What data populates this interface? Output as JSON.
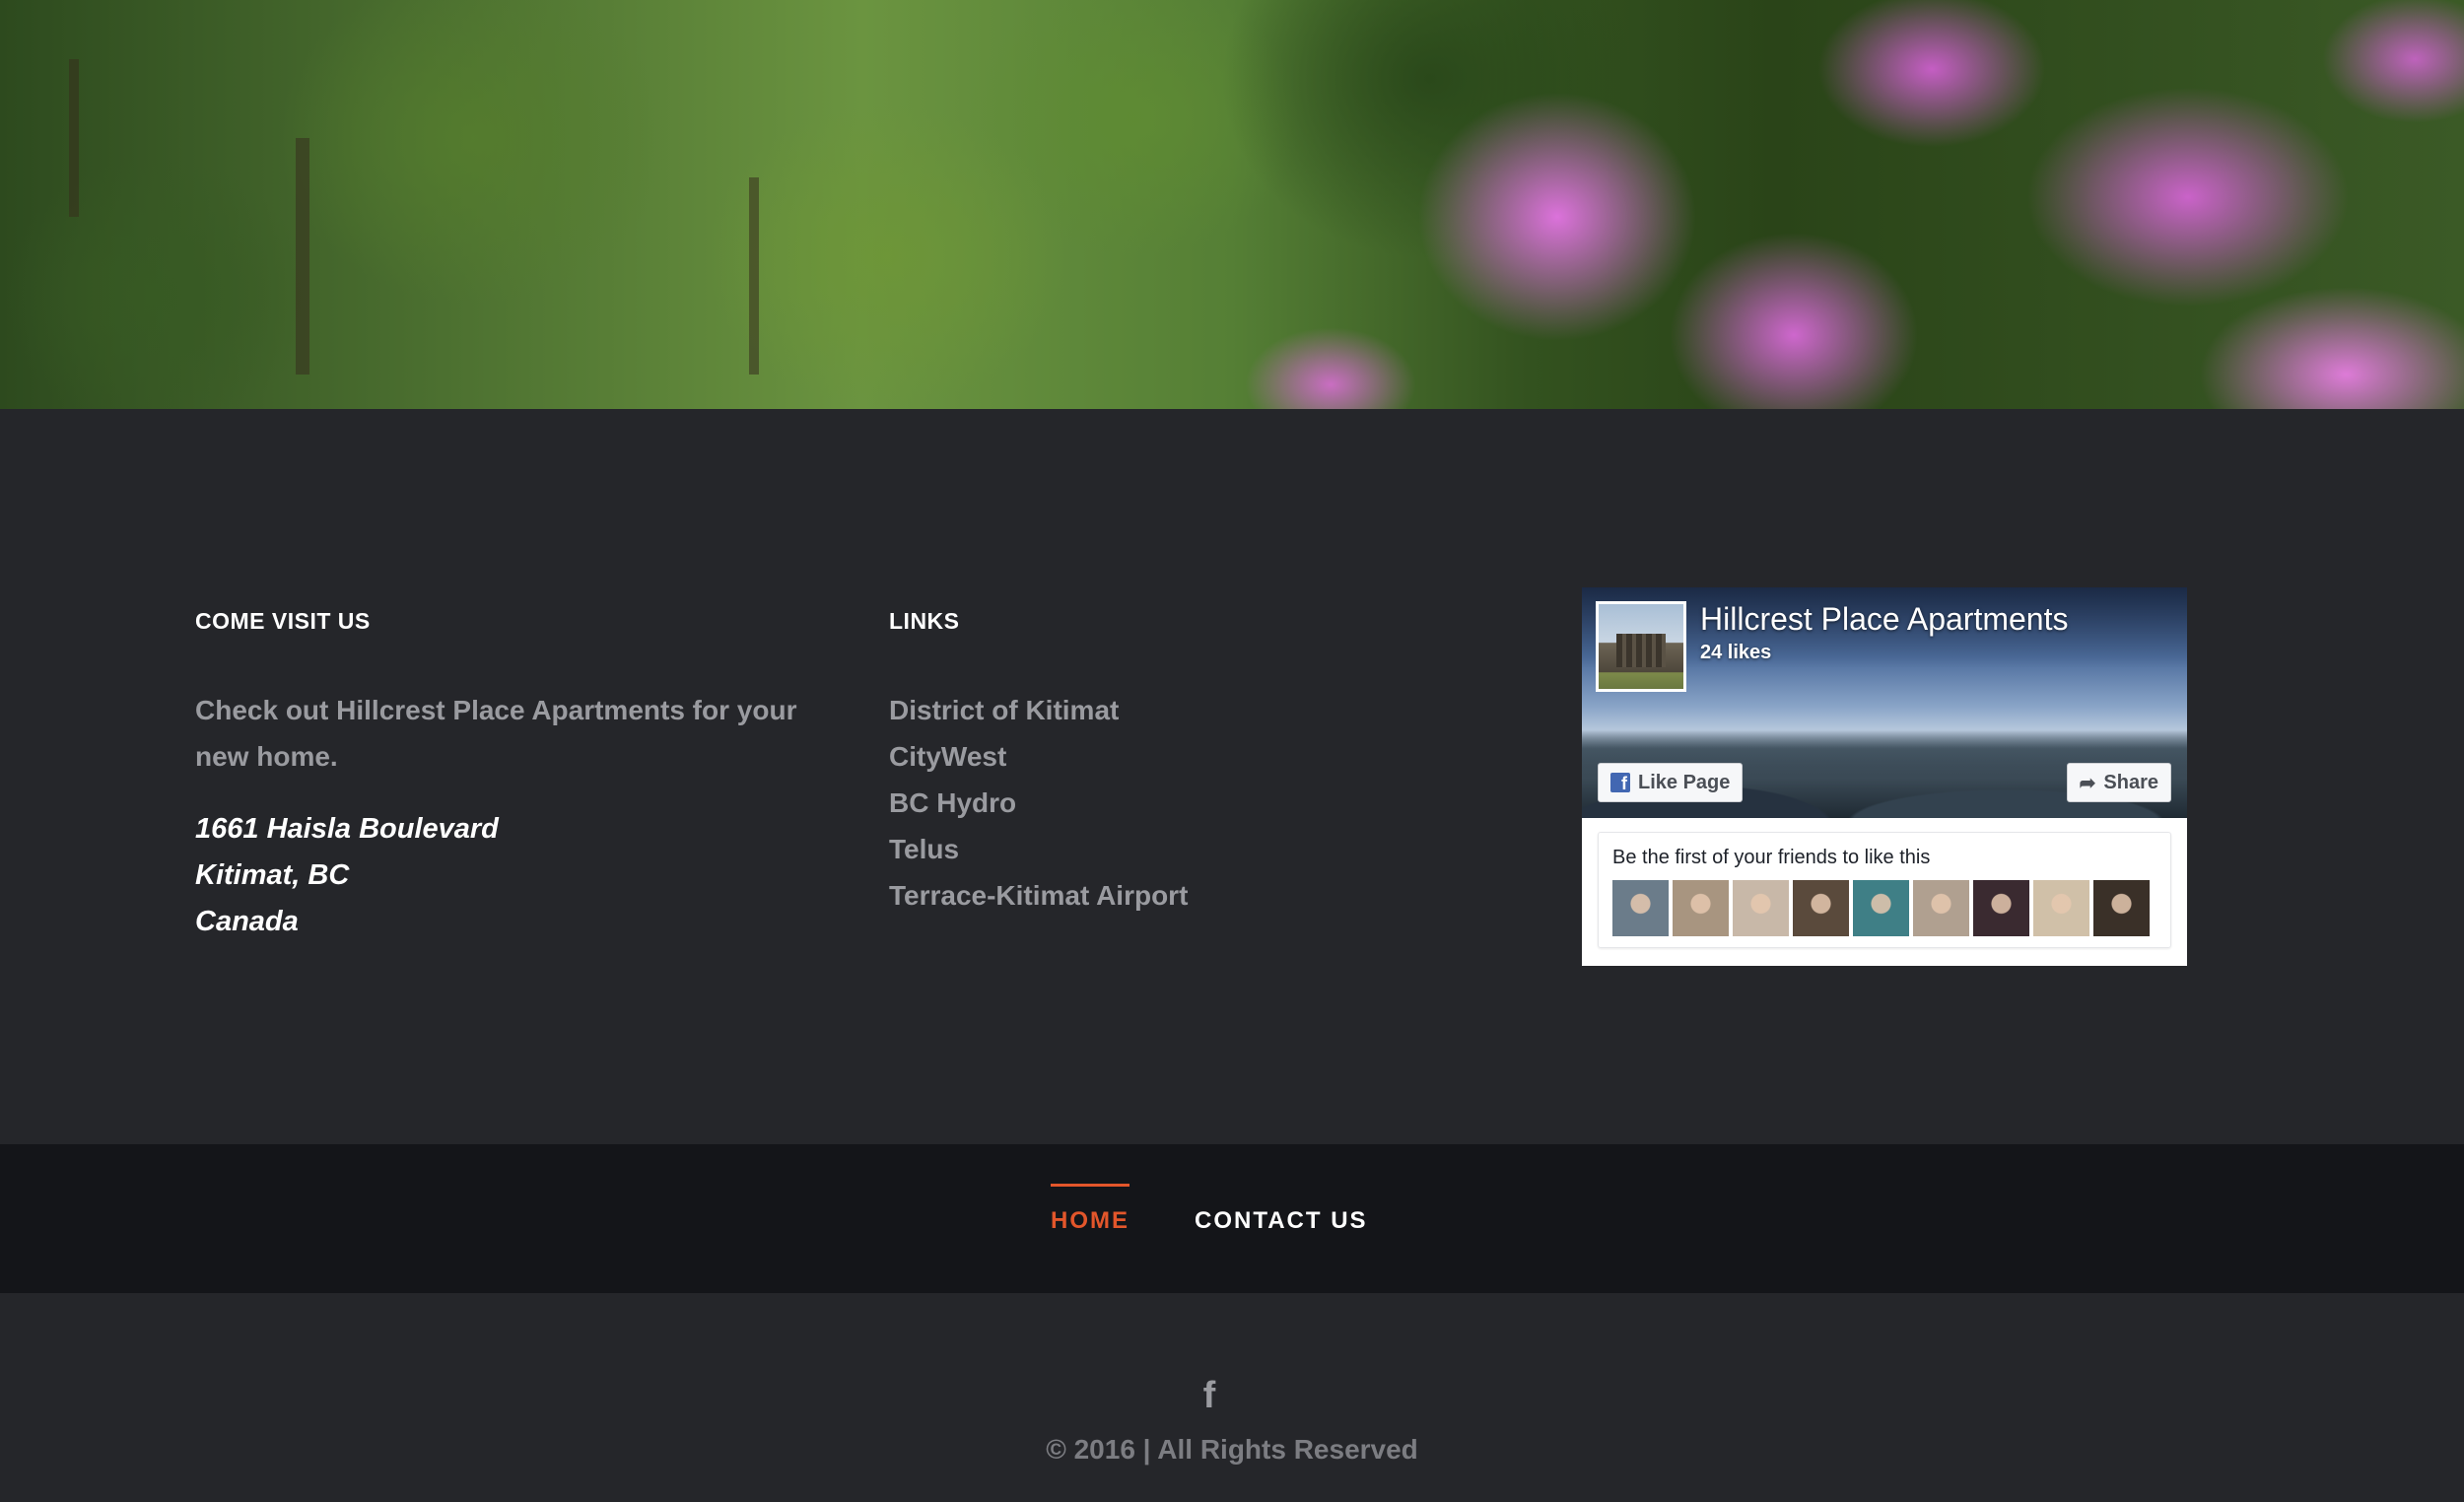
{
  "footer": {
    "visit": {
      "title": "COME VISIT US",
      "text": "Check out Hillcrest Place Apartments for your new home.",
      "address": [
        "1661 Haisla Boulevard",
        "Kitimat, BC",
        "Canada"
      ]
    },
    "links": {
      "title": "LINKS",
      "items": [
        "District of Kitimat",
        "CityWest",
        "BC Hydro",
        "Telus",
        "Terrace-Kitimat Airport"
      ]
    },
    "facebook_widget": {
      "page_name": "Hillcrest Place Apartments",
      "likes": "24 likes",
      "like_button": "Like Page",
      "share_button": "Share",
      "friends_text": "Be the first of your friends to like this",
      "friend_faces": [
        "#6b7c8a",
        "#a89580",
        "#c8b8a8",
        "#5a4a3c",
        "#3f7f86",
        "#b0a090",
        "#3a2a30",
        "#d0c0a8",
        "#3a3028"
      ]
    }
  },
  "nav": {
    "items": [
      {
        "label": "HOME",
        "active": true
      },
      {
        "label": "CONTACT US",
        "active": false
      }
    ],
    "accent_color": "#e3562b"
  },
  "bottom": {
    "social_icon": "facebook-icon",
    "copyright": "© 2016 | All Rights Reserved"
  }
}
